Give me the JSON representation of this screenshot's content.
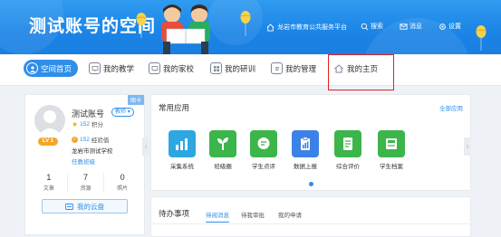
{
  "header": {
    "site_title": "测试账号的空间",
    "platform_link": "龙岩市教育公共服务平台",
    "search": "搜索",
    "messages": "消息",
    "settings": "设置"
  },
  "nav": {
    "items": [
      {
        "label": "空间首页",
        "icon": "home-circle-icon",
        "active": true
      },
      {
        "label": "我的教学",
        "icon": "monitor-icon"
      },
      {
        "label": "我的家校",
        "icon": "monitor-icon"
      },
      {
        "label": "我的研训",
        "icon": "grid-icon"
      },
      {
        "label": "我的管理",
        "icon": "document-icon"
      },
      {
        "label": "我的主页",
        "icon": "house-icon"
      }
    ]
  },
  "profile": {
    "tag": "图卡",
    "name": "测试账号",
    "role": "教师",
    "points_value": "152",
    "points_label": "积分",
    "exp_value": "152",
    "exp_label": "经验值",
    "level": "LV 1",
    "school": "龙岩市测试学校",
    "class_link": "任教班级",
    "stats": [
      {
        "value": "1",
        "label": "文章"
      },
      {
        "value": "7",
        "label": "资源"
      },
      {
        "value": "0",
        "label": "照片"
      }
    ],
    "cloud_button": "我的云盘"
  },
  "apps": {
    "title": "常用应用",
    "all_link": "全部应用",
    "items": [
      {
        "label": "采集系统",
        "color": "#2ea7e0"
      },
      {
        "label": "班级圈",
        "color": "#3cb54a"
      },
      {
        "label": "学生点评",
        "color": "#3cb54a"
      },
      {
        "label": "数据上报",
        "color": "#3c82e6"
      },
      {
        "label": "综合评价",
        "color": "#3cb54a"
      },
      {
        "label": "学生档案",
        "color": "#3cb54a"
      }
    ]
  },
  "todo": {
    "title": "待办事项",
    "tabs": [
      "待阅消息",
      "待我审批",
      "我的申请"
    ]
  },
  "colors": {
    "header_blue": "#1b84e6",
    "accent": "#2f8ee8",
    "highlight": "#e02020"
  }
}
